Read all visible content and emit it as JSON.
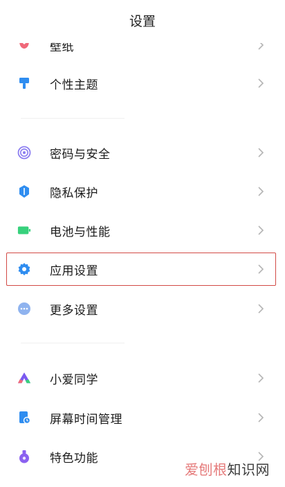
{
  "header": {
    "title": "设置"
  },
  "items": [
    {
      "label": "壁纸",
      "icon": "tulip-icon",
      "color": "#f0697a"
    },
    {
      "label": "个性主题",
      "icon": "paint-roller-icon",
      "color": "#2f8df0"
    },
    {
      "label": "密码与安全",
      "icon": "fingerprint-icon",
      "color": "#8b7df0"
    },
    {
      "label": "隐私保护",
      "icon": "shield-icon",
      "color": "#2f8df0"
    },
    {
      "label": "电池与性能",
      "icon": "battery-icon",
      "color": "#37d17c"
    },
    {
      "label": "应用设置",
      "icon": "gear-icon",
      "color": "#2f8df0"
    },
    {
      "label": "更多设置",
      "icon": "more-dots-icon",
      "color": "#8fb3ef"
    },
    {
      "label": "小爱同学",
      "icon": "xiaoai-icon",
      "color": "#7a5af0"
    },
    {
      "label": "屏幕时间管理",
      "icon": "screen-time-icon",
      "color": "#2f8df0"
    },
    {
      "label": "特色功能",
      "icon": "flask-icon",
      "color": "#8b61f0"
    }
  ],
  "watermark": {
    "part1": "爱刨根",
    "part2": "知识网"
  }
}
